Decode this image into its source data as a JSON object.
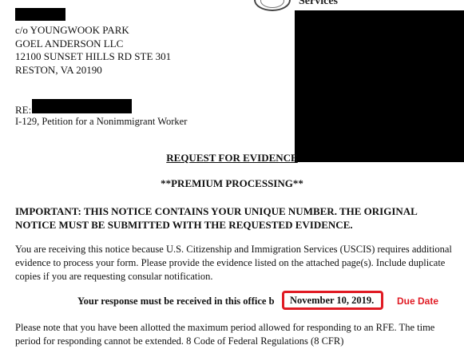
{
  "letterhead": {
    "agency_fragment": "Services"
  },
  "address": {
    "lines": [
      "c/o YOUNGWOOK PARK",
      "GOEL ANDERSON LLC",
      "12100 SUNSET HILLS RD STE 301",
      "RESTON, VA 20190"
    ]
  },
  "re": {
    "label": "RE:",
    "form": "I-129, Petition for a Nonimmigrant Worker"
  },
  "notice": {
    "title": "REQUEST FOR EVIDENCE",
    "premium": "**PREMIUM PROCESSING**",
    "important": "IMPORTANT: THIS NOTICE CONTAINS YOUR UNIQUE NUMBER. THE ORIGINAL NOTICE MUST BE SUBMITTED WITH THE REQUESTED EVIDENCE.",
    "body_paragraph": "You are receiving this notice because U.S. Citizenship and Immigration Services (USCIS) requires additional evidence to process your form.  Please provide the evidence listed on the attached page(s). Include duplicate copies if you are requesting consular notification.",
    "response_text": "Your response must be received in this office b",
    "due_date": "November 10, 2019.",
    "closing_paragraph": "Please note that you have been allotted the maximum period allowed for responding to an RFE.  The time period for responding cannot be extended.  8 Code of Federal Regulations (8 CFR)"
  },
  "annotation": {
    "due_label": "Due Date",
    "highlight_color": "#e01b24"
  }
}
